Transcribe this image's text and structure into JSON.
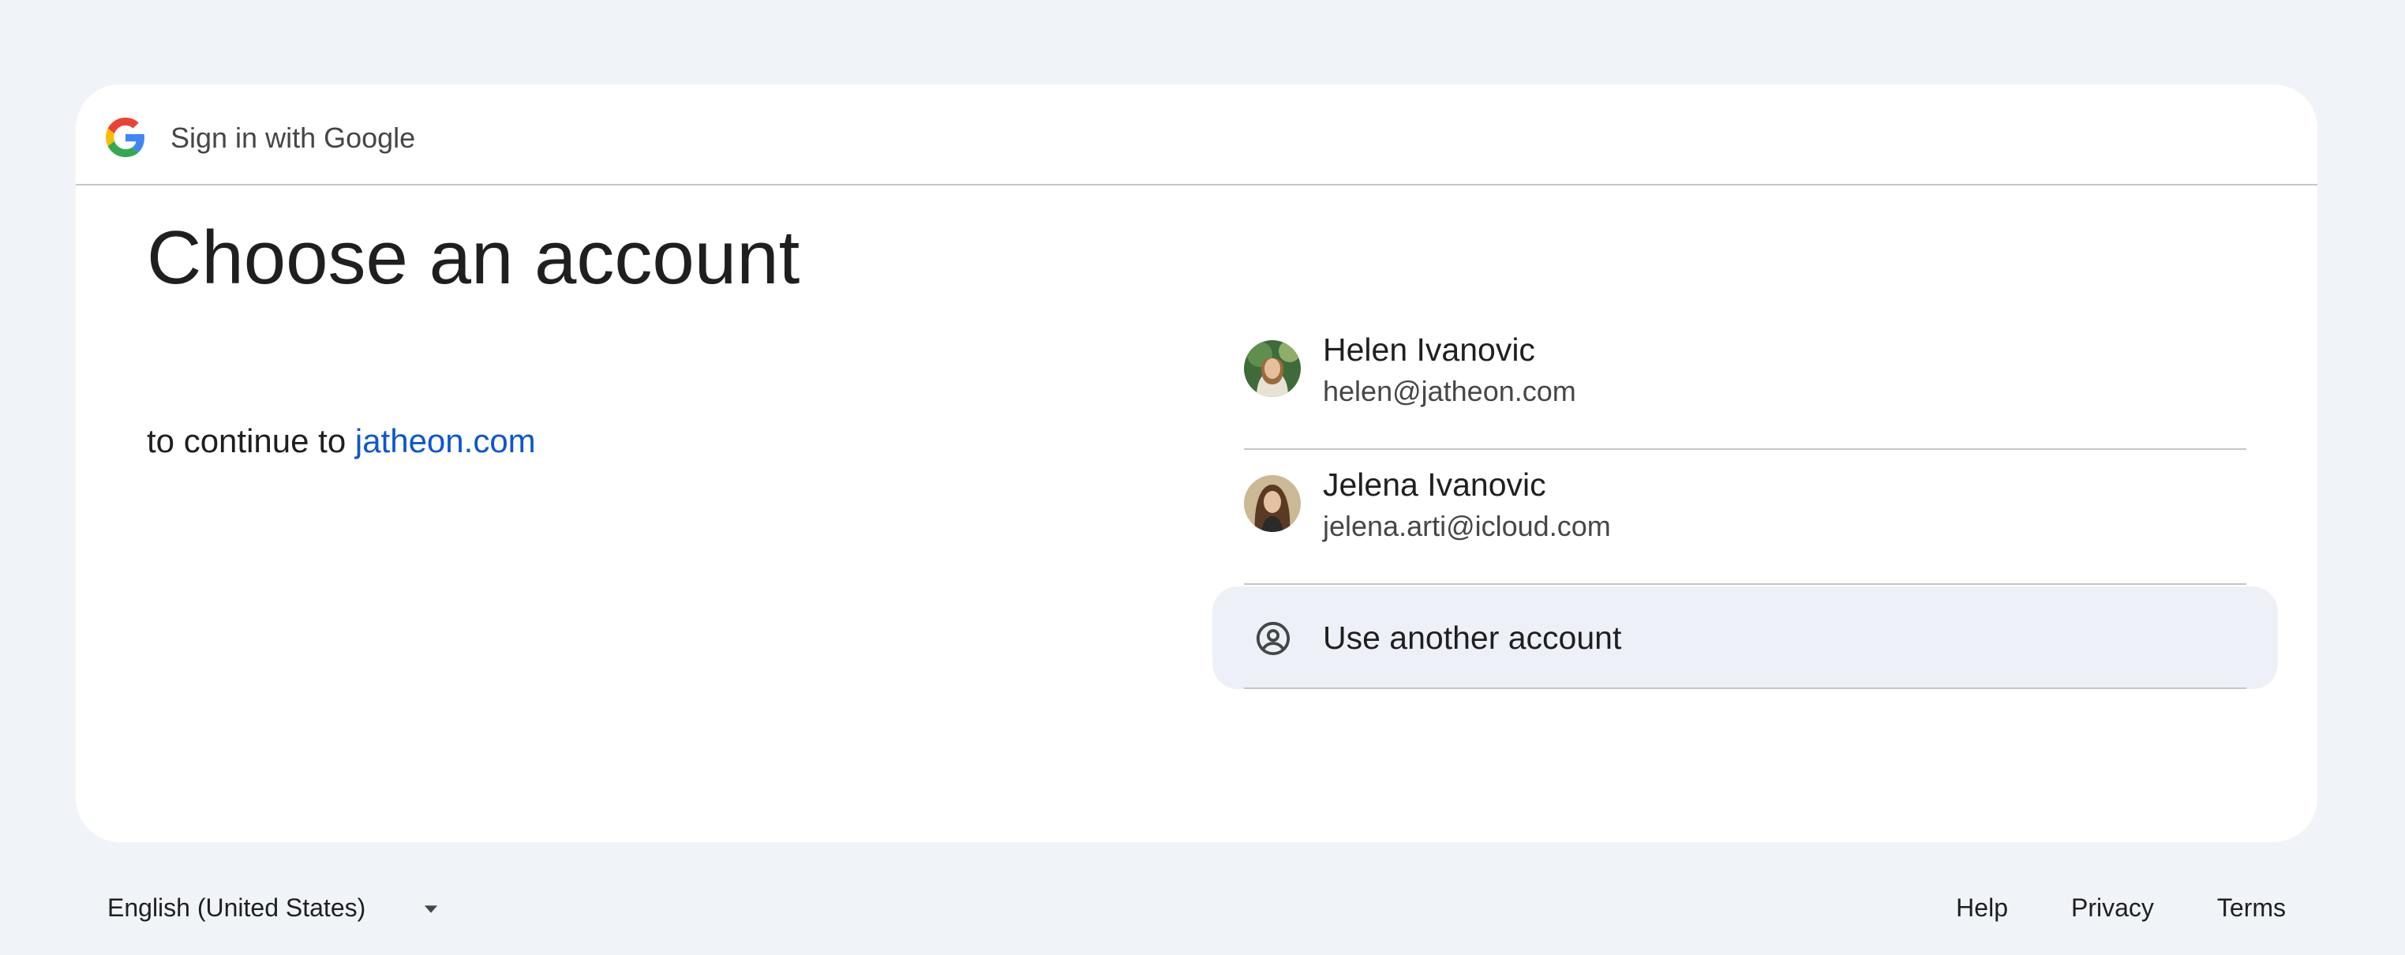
{
  "header": {
    "title": "Sign in with Google",
    "logo_icon": "google-g-icon"
  },
  "main": {
    "heading": "Choose an account",
    "subheading_prefix": "to continue to",
    "subheading_link": "jatheon.com"
  },
  "accounts": [
    {
      "name": "Helen Ivanovic",
      "email": "helen@jatheon.com",
      "avatar_icon": "avatar-photo"
    },
    {
      "name": "Jelena Ivanovic",
      "email": "jelena.arti@icloud.com",
      "avatar_icon": "avatar-photo"
    }
  ],
  "use_another": {
    "label": "Use another account",
    "icon": "account-circle-icon"
  },
  "footer": {
    "language": "English (United States)",
    "links": [
      "Help",
      "Privacy",
      "Terms"
    ]
  },
  "colors": {
    "page_bg": "#f0f4f9",
    "card_bg": "#ffffff",
    "link": "#0b57d0",
    "hover_bg": "#edf1f7",
    "divider": "#c4c7c5"
  }
}
